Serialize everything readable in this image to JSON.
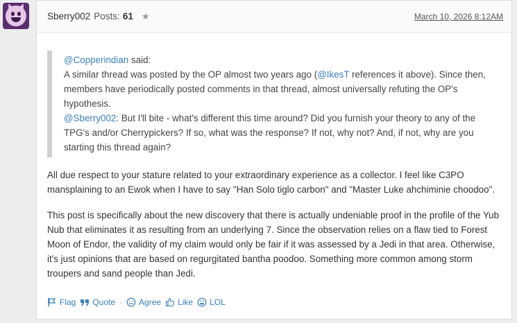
{
  "author": {
    "username": "Sberry002",
    "posts_label": "Posts:",
    "posts_count": "61",
    "star": "★"
  },
  "post_date": "March 10, 2026 8:12AM",
  "quote": {
    "mention": "@Copperindian",
    "said_label": "said:",
    "text_before_link": "A similar thread was posted by the OP almost two years ago (",
    "inline_mention": "@IkesT",
    "text_after_link": " references it above). Since then, members have periodically posted comments in that thread, almost universally refuting the OP's hypothesis.",
    "reply_mention": "@Sberry002",
    "reply_text": ": But I'll bite - what's different this time around? Did you furnish your theory to any of the TPG's and/or Cherrypickers? If so, what was the response? If not, why not? And, if not, why are you starting this thread again?"
  },
  "paragraphs": [
    "All due respect to your stature related to your extraordinary experience as a collector. I feel like C3PO mansplaining to an Ewok when I have to say \"Han Solo tiglo carbon\" and \"Master Luke ahchiminie choodoo\".",
    "This post is specifically about the new discovery that there is actually undeniable proof in the profile of the Yub Nub that eliminates it as resulting from an underlying 7. Since the observation relies on a flaw tied to Forest Moon of Endor, the validity of my claim would only be fair if it was assessed by a Jedi in that area. Otherwise, it's just opinions that are based on regurgitated bantha poodoo. Something more common among storm troupers and sand people than Jedi."
  ],
  "actions": {
    "flag": "Flag",
    "quote": "Quote",
    "separator": "·",
    "agree": "Agree",
    "like": "Like",
    "lol": "LOL"
  },
  "colors": {
    "link": "#3a7fbd",
    "avatar_bg": "#5a2e6e"
  }
}
